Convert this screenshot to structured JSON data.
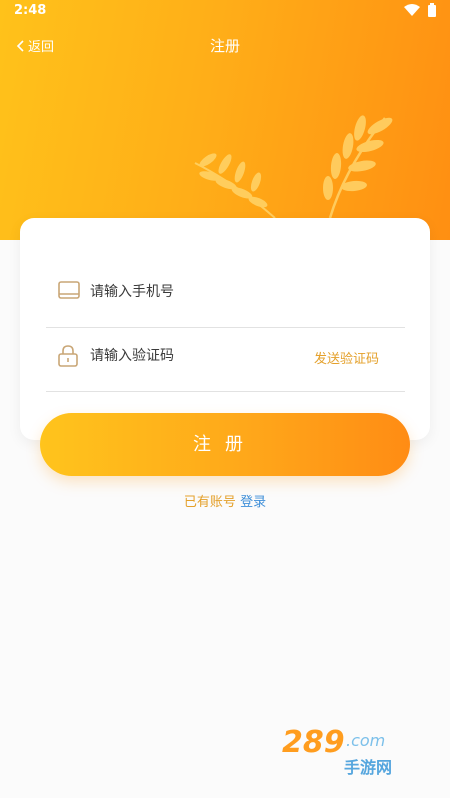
{
  "status_bar": {
    "time": "2:48",
    "icons": [
      "wifi-icon",
      "battery-icon"
    ]
  },
  "nav": {
    "back_label": "返回",
    "title": "注册"
  },
  "form": {
    "phone_placeholder": "请输入手机号",
    "code_placeholder": "请输入验证码",
    "send_code_label": "发送验证码"
  },
  "register_button": "注册",
  "login_prompt": {
    "prefix": "已有账号",
    "link": "登录"
  },
  "watermark": {
    "text": "289.com 手游网"
  },
  "colors": {
    "header_start": "#ffc21a",
    "header_end": "#ff8f12",
    "accent_text": "#e4a02a",
    "link": "#3f8fd8"
  }
}
